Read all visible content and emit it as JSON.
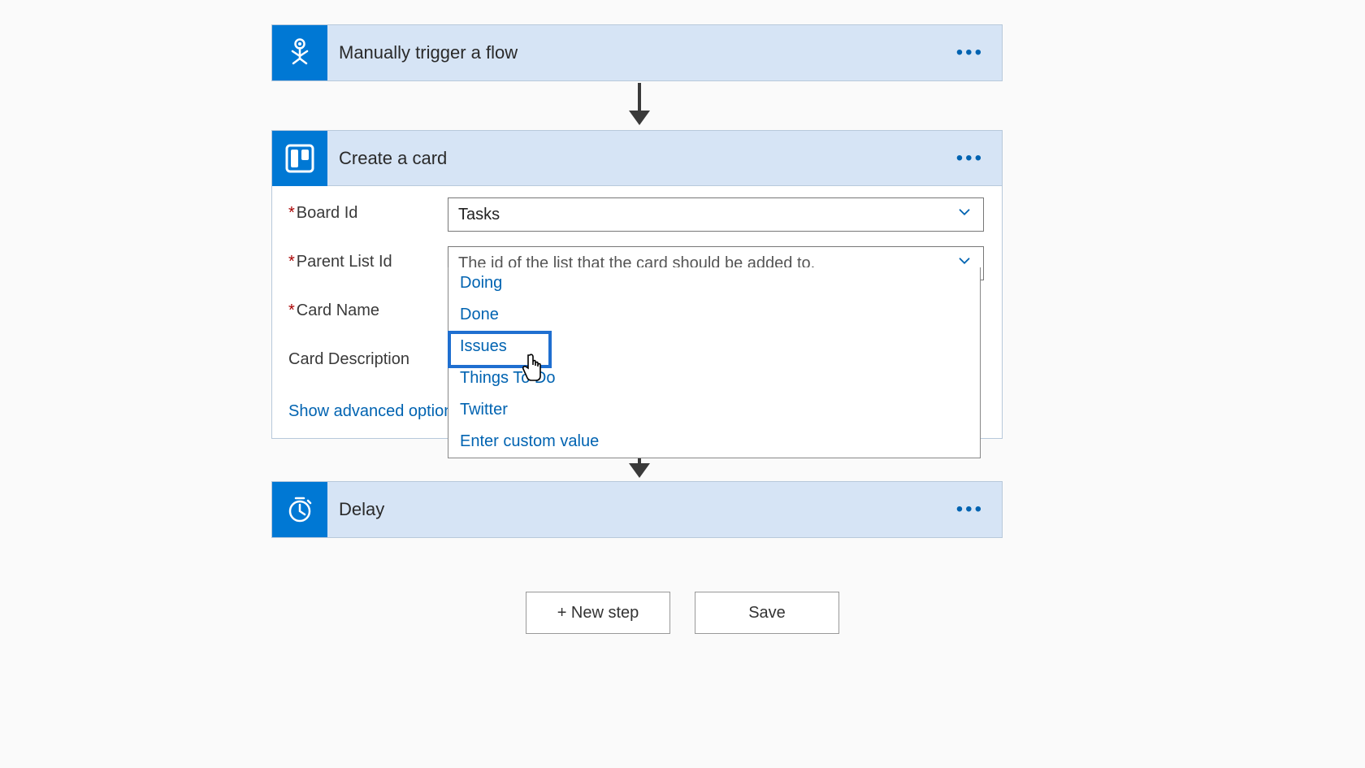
{
  "trigger": {
    "title": "Manually trigger a flow"
  },
  "action_create": {
    "title": "Create a card",
    "labels": {
      "board_id": "Board Id",
      "parent_list_id": "Parent List Id",
      "card_name": "Card Name",
      "card_description": "Card Description"
    },
    "board_value": "Tasks",
    "parent_placeholder": "The id of the list that the card should be added to.",
    "advanced_link": "Show advanced options",
    "dropdown_options": [
      "Doing",
      "Done",
      "Issues",
      "Things To Do",
      "Twitter",
      "Enter custom value"
    ],
    "highlighted_option": "Issues"
  },
  "action_delay": {
    "title": "Delay"
  },
  "buttons": {
    "new_step": "+ New step",
    "save": "Save"
  }
}
